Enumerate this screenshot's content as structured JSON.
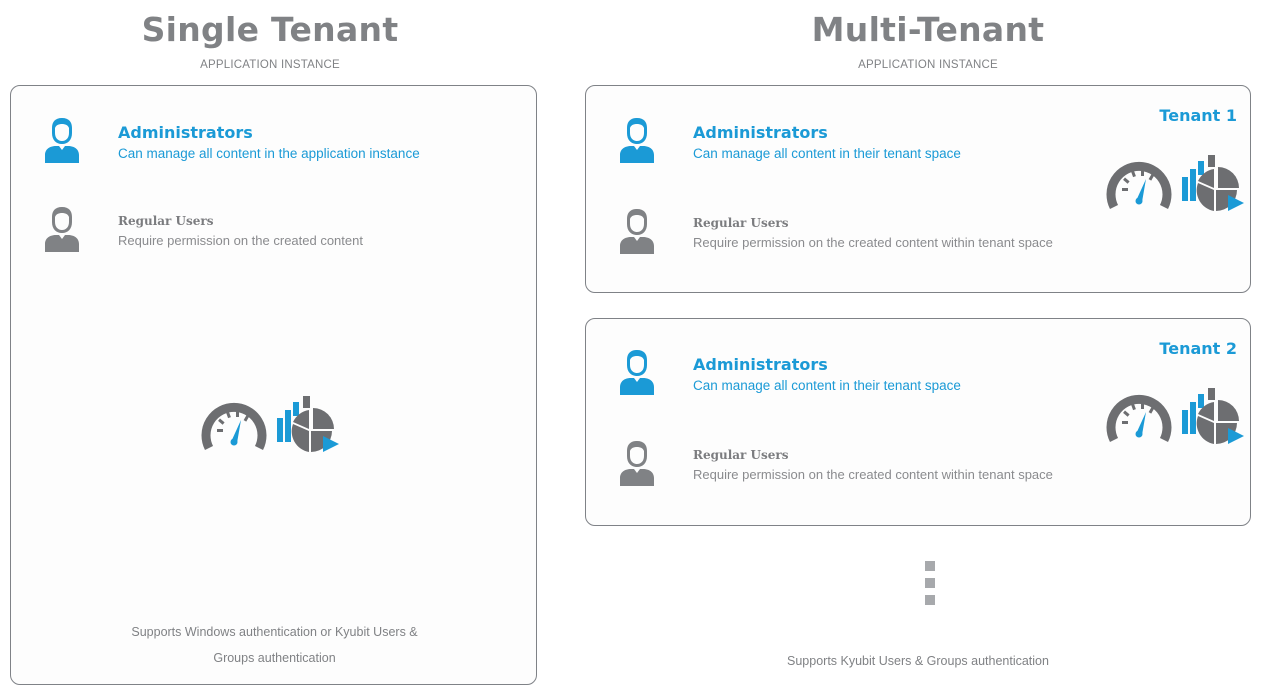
{
  "single": {
    "title": "Single Tenant",
    "subtitle": "APPLICATION INSTANCE",
    "admin": {
      "heading": "Administrators",
      "desc": "Can manage all content in the application instance",
      "icon": "admin-user-icon"
    },
    "regular": {
      "heading": "Regular Users",
      "desc": "Require permission on the created content",
      "icon": "regular-user-icon"
    },
    "footnote_line1": "Supports Windows authentication or Kyubit Users &",
    "footnote_line2": "Groups authentication"
  },
  "multi": {
    "title": "Multi-Tenant",
    "subtitle": "APPLICATION INSTANCE",
    "tenants": [
      {
        "label": "Tenant 1",
        "admin": {
          "heading": "Administrators",
          "desc": "Can manage all content in their tenant space"
        },
        "regular": {
          "heading": "Regular Users",
          "desc": "Require permission on the created content within tenant space"
        }
      },
      {
        "label": "Tenant 2",
        "admin": {
          "heading": "Administrators",
          "desc": "Can manage all content in their tenant space"
        },
        "regular": {
          "heading": "Regular Users",
          "desc": "Require permission on the created content within tenant space"
        }
      }
    ],
    "footnote": "Supports Kyubit Users & Groups authentication"
  },
  "icons": [
    "dashboard-gauge-icon",
    "analysis-chart-icon"
  ],
  "colors": {
    "accent": "#1b9ad6",
    "gray": "#808285",
    "border": "#7f8287"
  }
}
